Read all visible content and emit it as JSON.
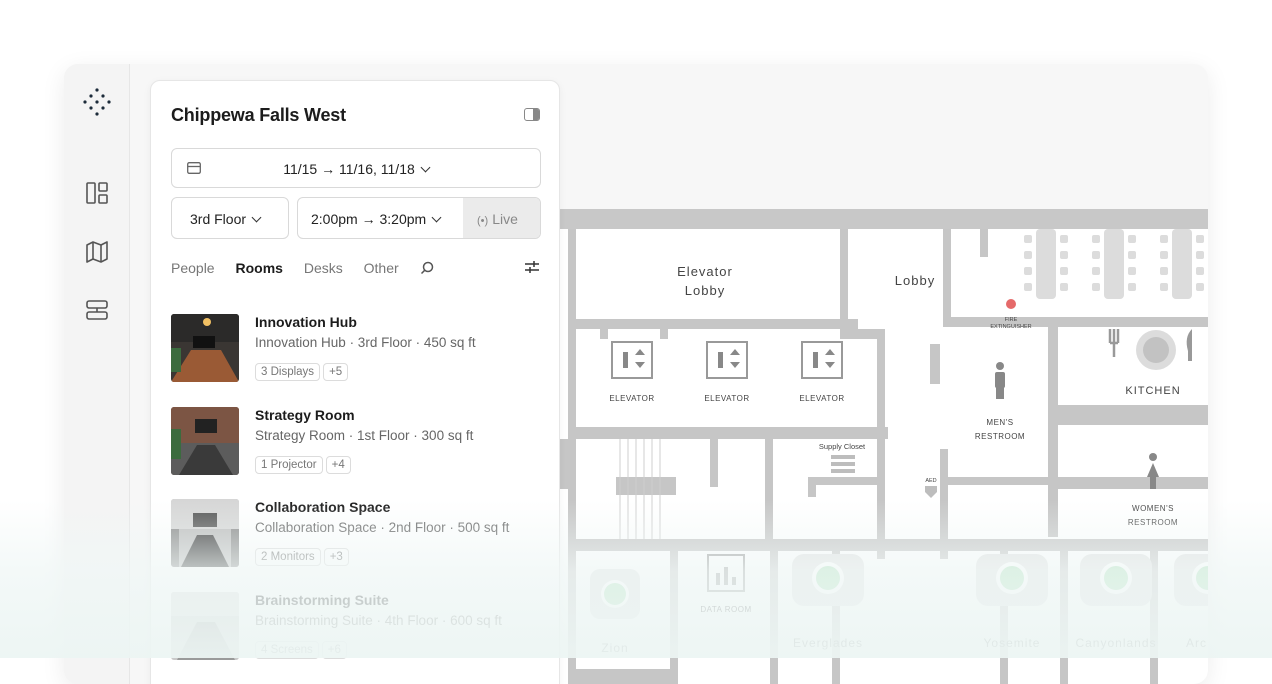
{
  "panel": {
    "title": "Chippewa Falls West",
    "date_range": "11/15 → 11/16, 11/18",
    "floor": "3rd Floor",
    "time_range": "2:00pm → 3:20pm",
    "live_label": "Live"
  },
  "tabs": [
    {
      "label": "People"
    },
    {
      "label": "Rooms",
      "active": true
    },
    {
      "label": "Desks"
    },
    {
      "label": "Other"
    }
  ],
  "rooms": [
    {
      "name": "Innovation Hub",
      "meta": "Innovation Hub · 3rd Floor · 450 sq ft",
      "tags": [
        "3 Displays",
        "+5"
      ]
    },
    {
      "name": "Strategy Room",
      "meta": "Strategy Room · 1st Floor · 300 sq ft",
      "tags": [
        "1 Projector",
        "+4"
      ]
    },
    {
      "name": "Collaboration Space",
      "meta": "Collaboration Space · 2nd Floor · 500 sq ft",
      "tags": [
        "2 Monitors",
        "+3"
      ]
    },
    {
      "name": "Brainstorming Suite",
      "meta": "Brainstorming Suite · 4th Floor · 600 sq ft",
      "tags": [
        "4 Screens",
        "+6"
      ]
    }
  ],
  "map": {
    "elevator_lobby": [
      "Elevator",
      "Lobby"
    ],
    "lobby": "Lobby",
    "elevator": "ELEVATOR",
    "supply_closet": "Supply Closet",
    "fire_ext": [
      "FIRE",
      "EXTINGUISHER"
    ],
    "kitchen": "KITCHEN",
    "mens": [
      "MEN'S",
      "RESTROOM"
    ],
    "womens": [
      "WOMEN'S",
      "RESTROOM"
    ],
    "aed": "AED",
    "data_room": "DATA ROOM",
    "rooms": [
      "Zion",
      "Everglades",
      "Yosemite",
      "Canyonlands",
      "Arc"
    ]
  },
  "colors": {
    "accent": "#1c2b3a",
    "available": "#a8e0b5",
    "wall": "#c6c6c6"
  }
}
